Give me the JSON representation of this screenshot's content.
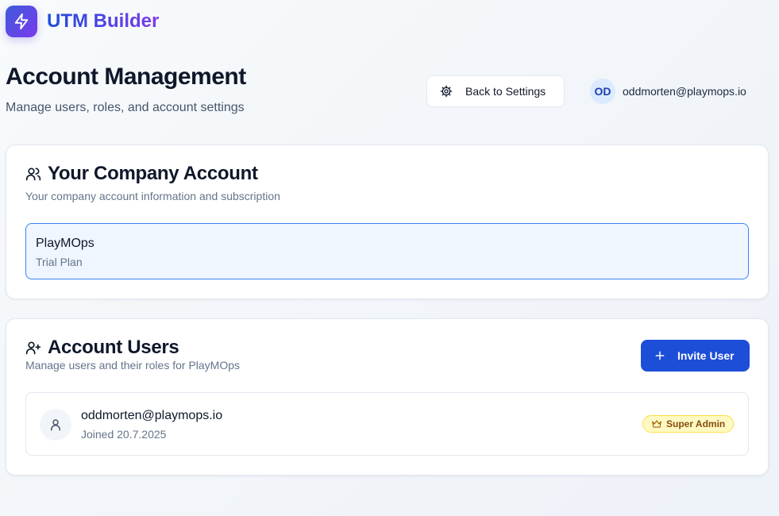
{
  "app": {
    "title": "UTM Builder",
    "logo_icon": "lightning-bolt-icon",
    "brand_gradient": [
      "#3b5bdb",
      "#7c3aed"
    ]
  },
  "header": {
    "title": "Account Management",
    "subtitle": "Manage users, roles, and account settings",
    "back_button": {
      "label": "Back to Settings",
      "icon": "gear-icon"
    },
    "user": {
      "initials": "OD",
      "email": "oddmorten@playmops.io"
    }
  },
  "company_card": {
    "icon": "users-icon",
    "title": "Your Company Account",
    "description": "Your company account information and subscription",
    "company": {
      "name": "PlayMOps",
      "plan": "Trial Plan"
    }
  },
  "users_card": {
    "icon": "user-plus-icon",
    "title": "Account Users",
    "description": "Manage users and their roles for PlayMOps",
    "invite_button": {
      "label": "Invite User",
      "icon": "plus-icon"
    },
    "users": [
      {
        "email": "oddmorten@playmops.io",
        "joined": "Joined 20.7.2025",
        "role": "Super Admin",
        "role_icon": "crown-icon",
        "avatar_icon": "user-icon"
      }
    ]
  },
  "colors": {
    "primary": "#1d4ed8",
    "selected_border": "#3b82f6",
    "selected_bg": "#eff6ff",
    "badge_bg": "#fef9c3",
    "badge_text": "#854d0e"
  }
}
